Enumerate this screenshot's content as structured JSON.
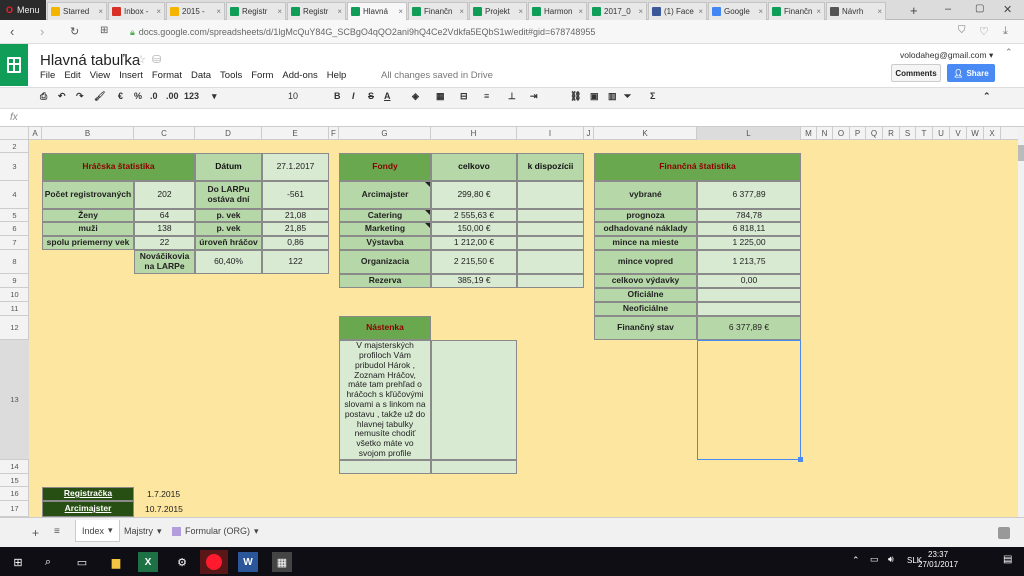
{
  "browser": {
    "menu_label": "Menu",
    "tabs": [
      {
        "label": "Starred",
        "color": "#f4b400"
      },
      {
        "label": "Inbox -",
        "color": "#d93025"
      },
      {
        "label": "2015 -",
        "color": "#f4b400"
      },
      {
        "label": "Registr",
        "color": "#0f9d58"
      },
      {
        "label": "Registr",
        "color": "#0f9d58"
      },
      {
        "label": "Hlavná",
        "color": "#0f9d58"
      },
      {
        "label": "Finančn",
        "color": "#0f9d58"
      },
      {
        "label": "Projekt",
        "color": "#0f9d58"
      },
      {
        "label": "Harmon",
        "color": "#0f9d58"
      },
      {
        "label": "2017_0",
        "color": "#0f9d58"
      },
      {
        "label": "(1) Face",
        "color": "#3b5998"
      },
      {
        "label": "Google",
        "color": "#4285f4"
      },
      {
        "label": "Finančn",
        "color": "#0f9d58"
      },
      {
        "label": "Návrh",
        "color": "#555555"
      }
    ],
    "url": "docs.google.com/spreadsheets/d/1lgMcQuY84G_SCBgO4qQO2ani9hQ4Ce2Vdkfa5EQbS1w/edit#gid=678748955"
  },
  "docs": {
    "title": "Hlavná tabuľka",
    "menu": [
      "File",
      "Edit",
      "View",
      "Insert",
      "Format",
      "Data",
      "Tools",
      "Form",
      "Add-ons",
      "Help"
    ],
    "saved": "All changes saved in Drive",
    "user": "volodaheg@gmail.com ▾",
    "comments": "Comments",
    "share": "Share"
  },
  "toolbar": {
    "zoom": "123",
    "font_size": "10",
    "fx": "fx"
  },
  "columns": [
    "A",
    "B",
    "C",
    "D",
    "E",
    "F",
    "G",
    "H",
    "I",
    "J",
    "K",
    "L",
    "M",
    "N",
    "O",
    "P",
    "Q",
    "R",
    "S",
    "T",
    "U",
    "V",
    "W",
    "X"
  ],
  "rows": [
    "2",
    "3",
    "4",
    "5",
    "6",
    "7",
    "8",
    "9",
    "10",
    "11",
    "12",
    "13",
    "14",
    "15",
    "16",
    "17"
  ],
  "hracska": {
    "title": "Hráčska štatistika",
    "datum_label": "Dátum",
    "datum_value": "27.1.2017",
    "r_pocet": "Počet registrovaných",
    "v_pocet": "202",
    "do_larpu": "Do LARPu ostáva dní",
    "v_do_larpu": "-561",
    "r_zeny": "Ženy",
    "v_zeny": "64",
    "l_pvek1": "p. vek",
    "v_pvek1": "21,08",
    "r_muzi": "muži",
    "v_muzi": "138",
    "l_pvek2": "p. vek",
    "v_pvek2": "21,85",
    "r_spolu": "spolu priemerny vek",
    "v_spolu": "22",
    "l_uroven": "úroveň hráčov",
    "v_uroven": "0,86",
    "novackovia": "Nováčikovia na LARPe",
    "v_nov_pct": "60,40%",
    "v_nov": "122"
  },
  "fondy": {
    "title": "Fondy",
    "col_celkovo": "celkovo",
    "col_dispozicii": "k dispozícii",
    "items": [
      {
        "label": "Arcimajster",
        "value": "299,80 €"
      },
      {
        "label": "Catering",
        "value": "2 555,63 €"
      },
      {
        "label": "Marketing",
        "value": "150,00 €"
      },
      {
        "label": "Výstavba",
        "value": "1 212,00 €"
      },
      {
        "label": "Organizacia",
        "value": "2 215,50 €"
      },
      {
        "label": "Rezerva",
        "value": "385,19 €"
      }
    ]
  },
  "financna": {
    "title": "Finančná štatistika",
    "items": [
      {
        "label": "vybrané",
        "value": "6 377,89"
      },
      {
        "label": "prognoza",
        "value": "784,78"
      },
      {
        "label": "odhadované náklady",
        "value": "6 818,11"
      },
      {
        "label": "mince na mieste",
        "value": "1 225,00"
      },
      {
        "label": "mince vopred",
        "value": "1 213,75"
      },
      {
        "label": "celkovo výdavky",
        "value": "0,00"
      },
      {
        "label": "Oficiálne",
        "value": ""
      },
      {
        "label": "Neoficiálne",
        "value": ""
      },
      {
        "label": "Finančný stav",
        "value": "6 377,89 €"
      }
    ]
  },
  "nastenka": {
    "title": "Nástenka",
    "text": "V majsterských profiloch Vám pribudol Hárok , Zoznam Hráčov, máte tam prehľad o hráčoch s kľúčovými slovami a s linkom na postavu , takže už do hlavnej tabulky nemusíte chodiť všetko máte vo svojom profile"
  },
  "dates": [
    {
      "label": "Registračka",
      "value": "1.7.2015"
    },
    {
      "label": "Arcimajster",
      "value": "10.7.2015"
    }
  ],
  "sheets": {
    "tabs": [
      "Index",
      "Majstry",
      "Formular (ORG)"
    ]
  },
  "taskbar": {
    "lang": "SLK",
    "time": "23:37",
    "date": "27/01/2017"
  }
}
